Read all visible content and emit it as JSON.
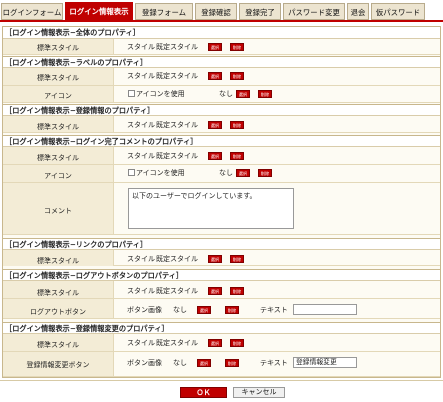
{
  "tabs": [
    "ログインフォーム",
    "ログイン情報表示",
    "登録フォーム",
    "登録確認",
    "登録完了",
    "パスワード変更",
    "退会",
    "仮パスワード"
  ],
  "active_tab_index": 1,
  "sections": {
    "whole": "［ログイン情報表示−全体のプロパティ］",
    "label": "［ログイン情報表示−ラベルのプロパティ］",
    "reginfo": "［ログイン情報表示−登録情報のプロパティ］",
    "complete": "［ログイン情報表示−ログイン完了コメントのプロパティ］",
    "link": "［ログイン情報表示−リンクのプロパティ］",
    "logout": "［ログイン情報表示−ログアウトボタンのプロパティ］",
    "regchange": "［ログイン情報表示−登録情報変更のプロパティ］"
  },
  "labels": {
    "std_style": "標準スタイル",
    "icon": "アイコン",
    "comment": "コメント",
    "logout_button": "ログアウトボタン",
    "regchange_button": "登録情報変更ボタン"
  },
  "values": {
    "style": "スタイル",
    "default_style": "既定スタイル",
    "select": "選択",
    "delete": "削除",
    "use_icon": "アイコンを使用",
    "none": "なし",
    "button_image": "ボタン画像",
    "text": "テキスト",
    "comment_text": "以下のユーザーでログインしています。",
    "logout_text": "",
    "regchange_text": "登録情報変更"
  },
  "footer": {
    "ok": "ＯＫ",
    "cancel": "キャンセル"
  },
  "colors": {
    "accent": "#c00000",
    "tab_bg": "#ece4d0",
    "label_bg": "#f3ecd6",
    "content_bg": "#fdfbf3"
  }
}
